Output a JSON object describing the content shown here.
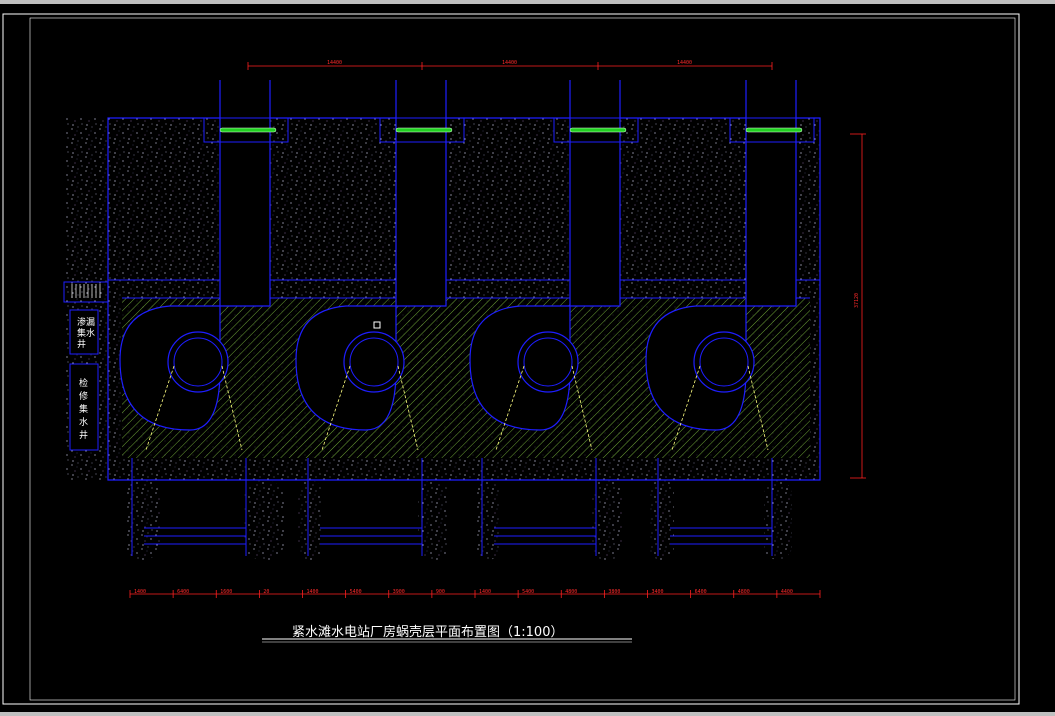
{
  "drawing": {
    "title": "紧水滩水电站厂房蜗壳层平面布置图（1:100）",
    "label_seepage_well": "渗漏集水井",
    "label_maintenance_well": "检修集水井",
    "top_dims": [
      "14400",
      "14400",
      "14400"
    ],
    "right_dim": "37120",
    "bottom_dims": [
      "1400",
      "6400",
      "1600",
      "20",
      "1400",
      "5400",
      "3900",
      "900",
      "1400",
      "5400",
      "4800",
      "3800",
      "3400",
      "6400",
      "4800",
      "4400"
    ],
    "colors": {
      "background": "#000000",
      "outline": "#1e1eff",
      "dimension": "#ff2020",
      "hatch": "#7fbf3f",
      "concrete_speckle": "#a0a0c0",
      "gate": "#20d020"
    }
  }
}
